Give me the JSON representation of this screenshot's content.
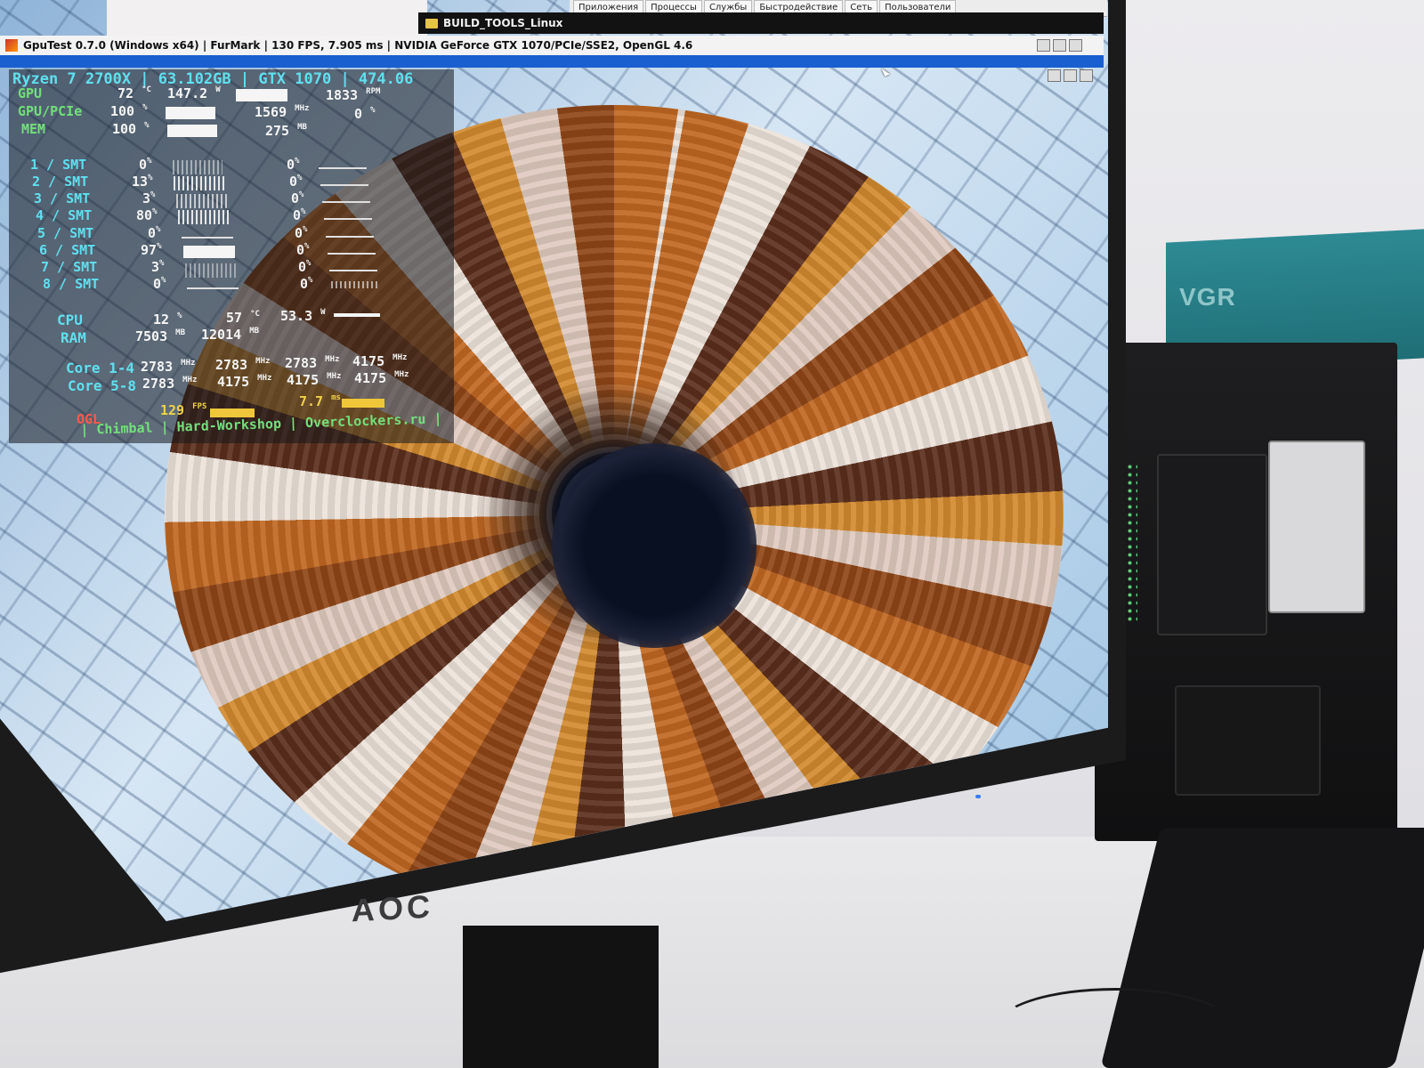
{
  "gputest": {
    "window_title": "GpuTest 0.7.0 (Windows x64) | FurMark | 130 FPS, 7.905 ms | NVIDIA GeForce GTX 1070/PCIe/SSE2, OpenGL 4.6"
  },
  "background_windows": {
    "build_folder_title": "BUILD_TOOLS_Linux",
    "task_manager_tabs": [
      "Приложения",
      "Процессы",
      "Службы",
      "Быстродействие",
      "Сеть",
      "Пользователи"
    ]
  },
  "hud": {
    "header": "Ryzen 7 2700X | 63.102GB | GTX 1070 | 474.06",
    "gpu": {
      "label": "GPU",
      "temp": "72",
      "temp_unit": "°C",
      "power": "147.2",
      "power_unit": "W",
      "fan": "1833",
      "fan_unit": "RPM"
    },
    "gpu_pcie": {
      "label": "GPU/PCIe",
      "load": "100",
      "load_unit": "%",
      "clock": "1569",
      "clock_unit": "MHz",
      "extra": "0",
      "extra_unit": "%"
    },
    "mem": {
      "label": "MEM",
      "load": "100",
      "load_unit": "%",
      "used": "275",
      "used_unit": "MB"
    },
    "threads": [
      {
        "label": "1 / SMT",
        "a": "0",
        "b": "0"
      },
      {
        "label": "2 / SMT",
        "a": "13",
        "b": "0"
      },
      {
        "label": "3 / SMT",
        "a": "3",
        "b": "0"
      },
      {
        "label": "4 / SMT",
        "a": "80",
        "b": "0"
      },
      {
        "label": "5 / SMT",
        "a": "0",
        "b": "0"
      },
      {
        "label": "6 / SMT",
        "a": "97",
        "b": "0"
      },
      {
        "label": "7 / SMT",
        "a": "3",
        "b": "0"
      },
      {
        "label": "8 / SMT",
        "a": "0",
        "b": "0"
      }
    ],
    "thread_unit": "%",
    "cpu": {
      "label": "CPU",
      "load": "12",
      "load_unit": "%",
      "temp": "57",
      "temp_unit": "°C",
      "power": "53.3",
      "power_unit": "W"
    },
    "ram": {
      "label": "RAM",
      "used": "7503",
      "used_unit": "MB",
      "total": "12014",
      "total_unit": "MB"
    },
    "core_1_4": {
      "label": "Core 1-4",
      "v1": "2783",
      "v2": "2783",
      "v3": "2783",
      "v4": "4175",
      "unit": "MHz"
    },
    "core_5_8": {
      "label": "Core 5-8",
      "v1": "2783",
      "v2": "4175",
      "v3": "4175",
      "v4": "4175",
      "unit": "MHz"
    },
    "ogl": {
      "label": "OGL",
      "fps": "129",
      "fps_unit": "FPS",
      "ms": "7.7",
      "ms_unit": "ms"
    },
    "credits": "| Chimbal | Hard-Workshop | Overclockers.ru |"
  },
  "scene": {
    "monitor_brand": "AOC",
    "box_label": "VGR"
  },
  "colors": {
    "hud_cyan": "#5fe0f0",
    "hud_green": "#72e07a",
    "hud_yellow": "#f1d24a",
    "hud_red": "#ff5a4a",
    "title_bar_blue": "#1a5fd0"
  }
}
